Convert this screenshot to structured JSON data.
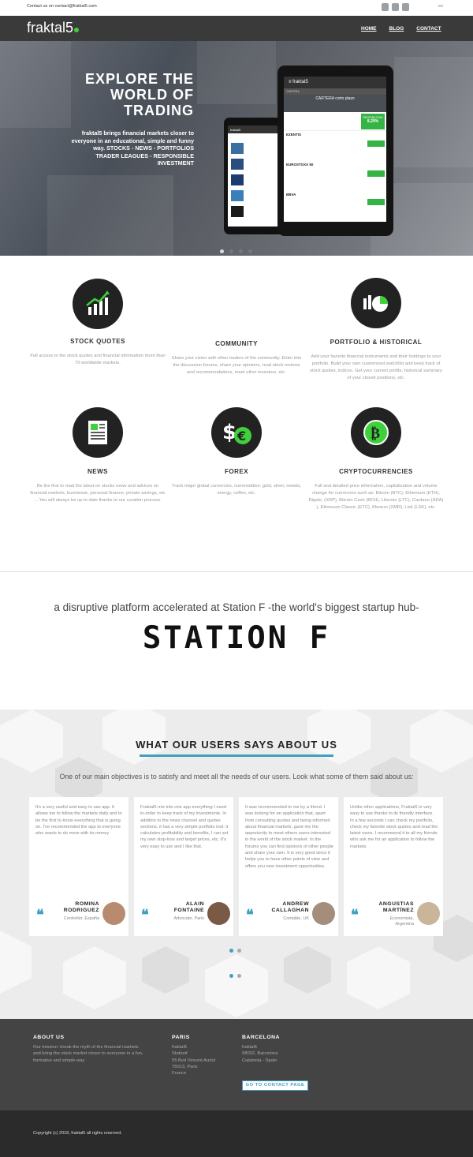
{
  "topbar": {
    "contact": "Contact us on contact@fraktal5.com",
    "social_icons": [
      "facebook-icon",
      "twitter-icon",
      "mail-icon"
    ],
    "lang": "en"
  },
  "nav": {
    "logo": "fraktal5",
    "items": [
      "HOME",
      "BLOG",
      "CONTACT"
    ]
  },
  "hero": {
    "title_lines": [
      "EXPLORE THE",
      "WORLD OF",
      "TRADING"
    ],
    "text_lines": [
      "fraktal5 brings financial markets closer to",
      "everyone in an educational, simple and funny",
      "way. STOCKS - NEWS - PORTFOLIOS",
      "TRADER LEAGUES - RESPONSIBLE",
      "INVESTMENT"
    ],
    "tablet": {
      "app_name": "fraktal5",
      "tab": "CARTERA",
      "portfolio": "CARTERA corto plazo",
      "rows": [
        "EZENTIS",
        "EUROSTOXX 50",
        "BBVA"
      ],
      "badge": "RENTABILIDAD",
      "value": "8,29%"
    },
    "phone": {
      "app_name": "fraktal5"
    },
    "carousel_active": 0,
    "carousel_count": 4
  },
  "features": [
    {
      "icon": "chart-growth-icon",
      "title": "STOCK QUOTES",
      "text": "Full access to the stock quotes and financial information more than 70 worldwide markets."
    },
    {
      "icon": "community-icon",
      "title": "COMMUNITY",
      "text": "Share your vision with other traders of the community. Enter into the discussion forums, share your opinions, read stock reviews and recommendations, meet other investors, etc."
    },
    {
      "icon": "portfolio-pie-icon",
      "title": "PORTFOLIO & HISTORICAL",
      "text": "Add your favorite financial instruments and their holdings to your portfolio. Build your own customized watchlist and keep track of stock quotes, indices. Get your current profits, historical summary of your closed positions, etc."
    },
    {
      "icon": "newspaper-icon",
      "title": "NEWS",
      "text": "Be the first to read the latest on stocks news and advices on financial markets, businesse, personal finance, private savings, etc ... You will always be up to date thanks to our curation process."
    },
    {
      "icon": "currency-dollar-euro-icon",
      "title": "FOREX",
      "text": "Track major global currencies, commodities: gold, silver, metals, energy, coffee, etc."
    },
    {
      "icon": "bitcoin-icon",
      "title": "CRYPTOCURRENCIES",
      "text": "Full and detailed price information, capitalization and volume change for currencies such as: Bitcoin (BTC), Ethereum (ETH), Ripple, (XRP), Bitcoin Cash (BCH), Litecoin (LTC), Cardano (ADA) ), Ethereum Classic (ETC), Monero (XMR), Lisk (LSK), etc."
    }
  ],
  "station": {
    "tagline": "a disruptive platform accelerated at Station F -the world's biggest startup hub-",
    "logo": "STATION F"
  },
  "testimonials": {
    "title": "WHAT OUR USERS SAYS ABOUT US",
    "intro": "One of our main objectives is to satisfy and meet all the needs of our users. Look what some of them said about us:",
    "items": [
      {
        "text": "It's a very useful and easy to use app. It allows me to follow the markets daily and to be the first to know everything that is going on. I've recommended the app to everyone who wants to do more with its money",
        "name1": "ROMINA",
        "name2": "RODRIGUEZ",
        "loc1": "Controller, España",
        "loc2": ""
      },
      {
        "text": "Fraktal5 mix into one app everything I need in-order to keep track of my investments. In addition to the news channel and quotes sections, it has a very simple portfolio tool: it calculates profitability and benefits, I can set my own stop-loss and target prices, etc. It's very easy to use and I like that.",
        "name1": "ALAIN",
        "name2": "FONTAINE",
        "loc1": "Advocate, Paris",
        "loc2": ""
      },
      {
        "text": "It was recommended to me by a friend. I was looking for an application that, apart from consulting quotes and being informed about financial markets, gave me the opportunity to meet others users interested in the world of the stock market. In the forums you can find opinions of other people and share your own. It is very good since it helps you to have other points of view and offers you new investment opportunities.",
        "name1": "ANDREW",
        "name2": "CALLAGHAN",
        "loc1": "Contable, UK",
        "loc2": ""
      },
      {
        "text": "Unlike other applications, Fraktal5 is very easy to use thanks to its friendly interface. In a few seconds I can check my portfolio, check my favorite stock quotes and read the latest news. I recommend it to all my friends who ask me for an application to follow the markets.",
        "name1": "ANGUSTIAS",
        "name2": "MARTÍNEZ",
        "loc1": "Economista,",
        "loc2": "Argentina"
      }
    ],
    "quote_mark": "❝"
  },
  "footer": {
    "about_title": "ABOUT US",
    "about_text": [
      "Our mission: break the myth of the financial markets",
      "and bring the stock market closer to everyone in a fun,",
      "formative and simple way"
    ],
    "paris_title": "PARIS",
    "paris_lines": [
      "fraktal5",
      "Stationf",
      "55 Bvd Vincent Auriol",
      "75013, Paris",
      "France"
    ],
    "barcelona_title": "BARCELONA",
    "barcelona_lines": [
      "fraktal5",
      "08032, Barcelona",
      "Catalonia - Spain"
    ],
    "button": "GO TO CONTACT PAGE",
    "copyright": "Copyright (c) 2018, fraktal5 all rights reserved."
  }
}
